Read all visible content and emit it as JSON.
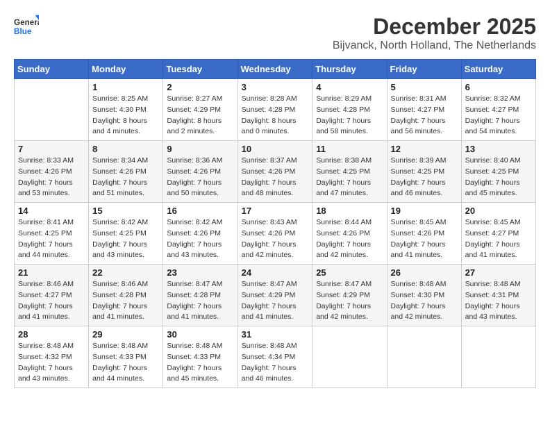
{
  "logo": {
    "line1": "General",
    "line2": "Blue"
  },
  "title": "December 2025",
  "location": "Bijvanck, North Holland, The Netherlands",
  "weekdays": [
    "Sunday",
    "Monday",
    "Tuesday",
    "Wednesday",
    "Thursday",
    "Friday",
    "Saturday"
  ],
  "weeks": [
    [
      {
        "day": "",
        "sunrise": "",
        "sunset": "",
        "daylight": ""
      },
      {
        "day": "1",
        "sunrise": "Sunrise: 8:25 AM",
        "sunset": "Sunset: 4:30 PM",
        "daylight": "Daylight: 8 hours and 4 minutes."
      },
      {
        "day": "2",
        "sunrise": "Sunrise: 8:27 AM",
        "sunset": "Sunset: 4:29 PM",
        "daylight": "Daylight: 8 hours and 2 minutes."
      },
      {
        "day": "3",
        "sunrise": "Sunrise: 8:28 AM",
        "sunset": "Sunset: 4:28 PM",
        "daylight": "Daylight: 8 hours and 0 minutes."
      },
      {
        "day": "4",
        "sunrise": "Sunrise: 8:29 AM",
        "sunset": "Sunset: 4:28 PM",
        "daylight": "Daylight: 7 hours and 58 minutes."
      },
      {
        "day": "5",
        "sunrise": "Sunrise: 8:31 AM",
        "sunset": "Sunset: 4:27 PM",
        "daylight": "Daylight: 7 hours and 56 minutes."
      },
      {
        "day": "6",
        "sunrise": "Sunrise: 8:32 AM",
        "sunset": "Sunset: 4:27 PM",
        "daylight": "Daylight: 7 hours and 54 minutes."
      }
    ],
    [
      {
        "day": "7",
        "sunrise": "Sunrise: 8:33 AM",
        "sunset": "Sunset: 4:26 PM",
        "daylight": "Daylight: 7 hours and 53 minutes."
      },
      {
        "day": "8",
        "sunrise": "Sunrise: 8:34 AM",
        "sunset": "Sunset: 4:26 PM",
        "daylight": "Daylight: 7 hours and 51 minutes."
      },
      {
        "day": "9",
        "sunrise": "Sunrise: 8:36 AM",
        "sunset": "Sunset: 4:26 PM",
        "daylight": "Daylight: 7 hours and 50 minutes."
      },
      {
        "day": "10",
        "sunrise": "Sunrise: 8:37 AM",
        "sunset": "Sunset: 4:26 PM",
        "daylight": "Daylight: 7 hours and 48 minutes."
      },
      {
        "day": "11",
        "sunrise": "Sunrise: 8:38 AM",
        "sunset": "Sunset: 4:25 PM",
        "daylight": "Daylight: 7 hours and 47 minutes."
      },
      {
        "day": "12",
        "sunrise": "Sunrise: 8:39 AM",
        "sunset": "Sunset: 4:25 PM",
        "daylight": "Daylight: 7 hours and 46 minutes."
      },
      {
        "day": "13",
        "sunrise": "Sunrise: 8:40 AM",
        "sunset": "Sunset: 4:25 PM",
        "daylight": "Daylight: 7 hours and 45 minutes."
      }
    ],
    [
      {
        "day": "14",
        "sunrise": "Sunrise: 8:41 AM",
        "sunset": "Sunset: 4:25 PM",
        "daylight": "Daylight: 7 hours and 44 minutes."
      },
      {
        "day": "15",
        "sunrise": "Sunrise: 8:42 AM",
        "sunset": "Sunset: 4:25 PM",
        "daylight": "Daylight: 7 hours and 43 minutes."
      },
      {
        "day": "16",
        "sunrise": "Sunrise: 8:42 AM",
        "sunset": "Sunset: 4:26 PM",
        "daylight": "Daylight: 7 hours and 43 minutes."
      },
      {
        "day": "17",
        "sunrise": "Sunrise: 8:43 AM",
        "sunset": "Sunset: 4:26 PM",
        "daylight": "Daylight: 7 hours and 42 minutes."
      },
      {
        "day": "18",
        "sunrise": "Sunrise: 8:44 AM",
        "sunset": "Sunset: 4:26 PM",
        "daylight": "Daylight: 7 hours and 42 minutes."
      },
      {
        "day": "19",
        "sunrise": "Sunrise: 8:45 AM",
        "sunset": "Sunset: 4:26 PM",
        "daylight": "Daylight: 7 hours and 41 minutes."
      },
      {
        "day": "20",
        "sunrise": "Sunrise: 8:45 AM",
        "sunset": "Sunset: 4:27 PM",
        "daylight": "Daylight: 7 hours and 41 minutes."
      }
    ],
    [
      {
        "day": "21",
        "sunrise": "Sunrise: 8:46 AM",
        "sunset": "Sunset: 4:27 PM",
        "daylight": "Daylight: 7 hours and 41 minutes."
      },
      {
        "day": "22",
        "sunrise": "Sunrise: 8:46 AM",
        "sunset": "Sunset: 4:28 PM",
        "daylight": "Daylight: 7 hours and 41 minutes."
      },
      {
        "day": "23",
        "sunrise": "Sunrise: 8:47 AM",
        "sunset": "Sunset: 4:28 PM",
        "daylight": "Daylight: 7 hours and 41 minutes."
      },
      {
        "day": "24",
        "sunrise": "Sunrise: 8:47 AM",
        "sunset": "Sunset: 4:29 PM",
        "daylight": "Daylight: 7 hours and 41 minutes."
      },
      {
        "day": "25",
        "sunrise": "Sunrise: 8:47 AM",
        "sunset": "Sunset: 4:29 PM",
        "daylight": "Daylight: 7 hours and 42 minutes."
      },
      {
        "day": "26",
        "sunrise": "Sunrise: 8:48 AM",
        "sunset": "Sunset: 4:30 PM",
        "daylight": "Daylight: 7 hours and 42 minutes."
      },
      {
        "day": "27",
        "sunrise": "Sunrise: 8:48 AM",
        "sunset": "Sunset: 4:31 PM",
        "daylight": "Daylight: 7 hours and 43 minutes."
      }
    ],
    [
      {
        "day": "28",
        "sunrise": "Sunrise: 8:48 AM",
        "sunset": "Sunset: 4:32 PM",
        "daylight": "Daylight: 7 hours and 43 minutes."
      },
      {
        "day": "29",
        "sunrise": "Sunrise: 8:48 AM",
        "sunset": "Sunset: 4:33 PM",
        "daylight": "Daylight: 7 hours and 44 minutes."
      },
      {
        "day": "30",
        "sunrise": "Sunrise: 8:48 AM",
        "sunset": "Sunset: 4:33 PM",
        "daylight": "Daylight: 7 hours and 45 minutes."
      },
      {
        "day": "31",
        "sunrise": "Sunrise: 8:48 AM",
        "sunset": "Sunset: 4:34 PM",
        "daylight": "Daylight: 7 hours and 46 minutes."
      },
      {
        "day": "",
        "sunrise": "",
        "sunset": "",
        "daylight": ""
      },
      {
        "day": "",
        "sunrise": "",
        "sunset": "",
        "daylight": ""
      },
      {
        "day": "",
        "sunrise": "",
        "sunset": "",
        "daylight": ""
      }
    ]
  ]
}
